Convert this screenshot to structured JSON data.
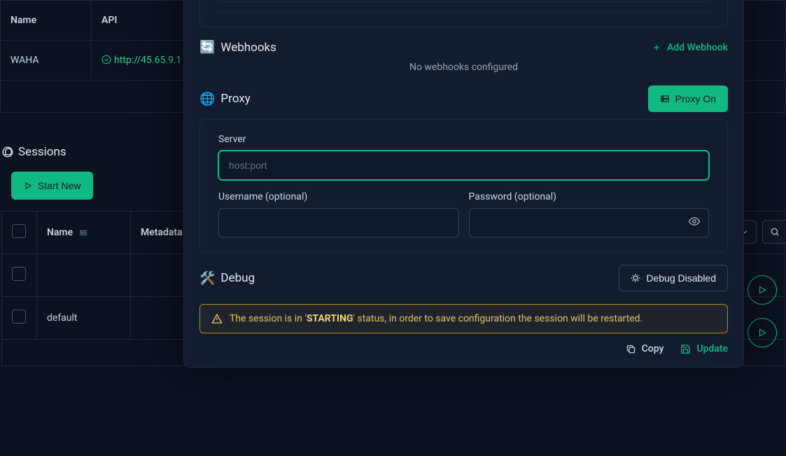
{
  "topTable": {
    "headers": {
      "name": "Name",
      "api": "API"
    },
    "row": {
      "name": "WAHA",
      "api": "http://45.65.9.1"
    }
  },
  "sessions": {
    "title": "Sessions",
    "startNew": "Start New",
    "columns": {
      "name": "Name",
      "metadata": "Metadata"
    },
    "rows": [
      {
        "name": ""
      },
      {
        "name": "default"
      }
    ]
  },
  "modal": {
    "webhooks": {
      "title": "Webhooks",
      "addLabel": "Add Webhook",
      "empty": "No webhooks configured"
    },
    "proxy": {
      "title": "Proxy",
      "toggleLabel": "Proxy On",
      "serverLabel": "Server",
      "serverPlaceholder": "host:port",
      "usernameLabel": "Username (optional)",
      "passwordLabel": "Password (optional)"
    },
    "debug": {
      "title": "Debug",
      "buttonLabel": "Debug Disabled"
    },
    "warning": {
      "prefix": "The session is in '",
      "status": "STARTING",
      "suffix": "' status, in order to save configuration the session will be restarted."
    },
    "footer": {
      "copy": "Copy",
      "update": "Update"
    }
  }
}
